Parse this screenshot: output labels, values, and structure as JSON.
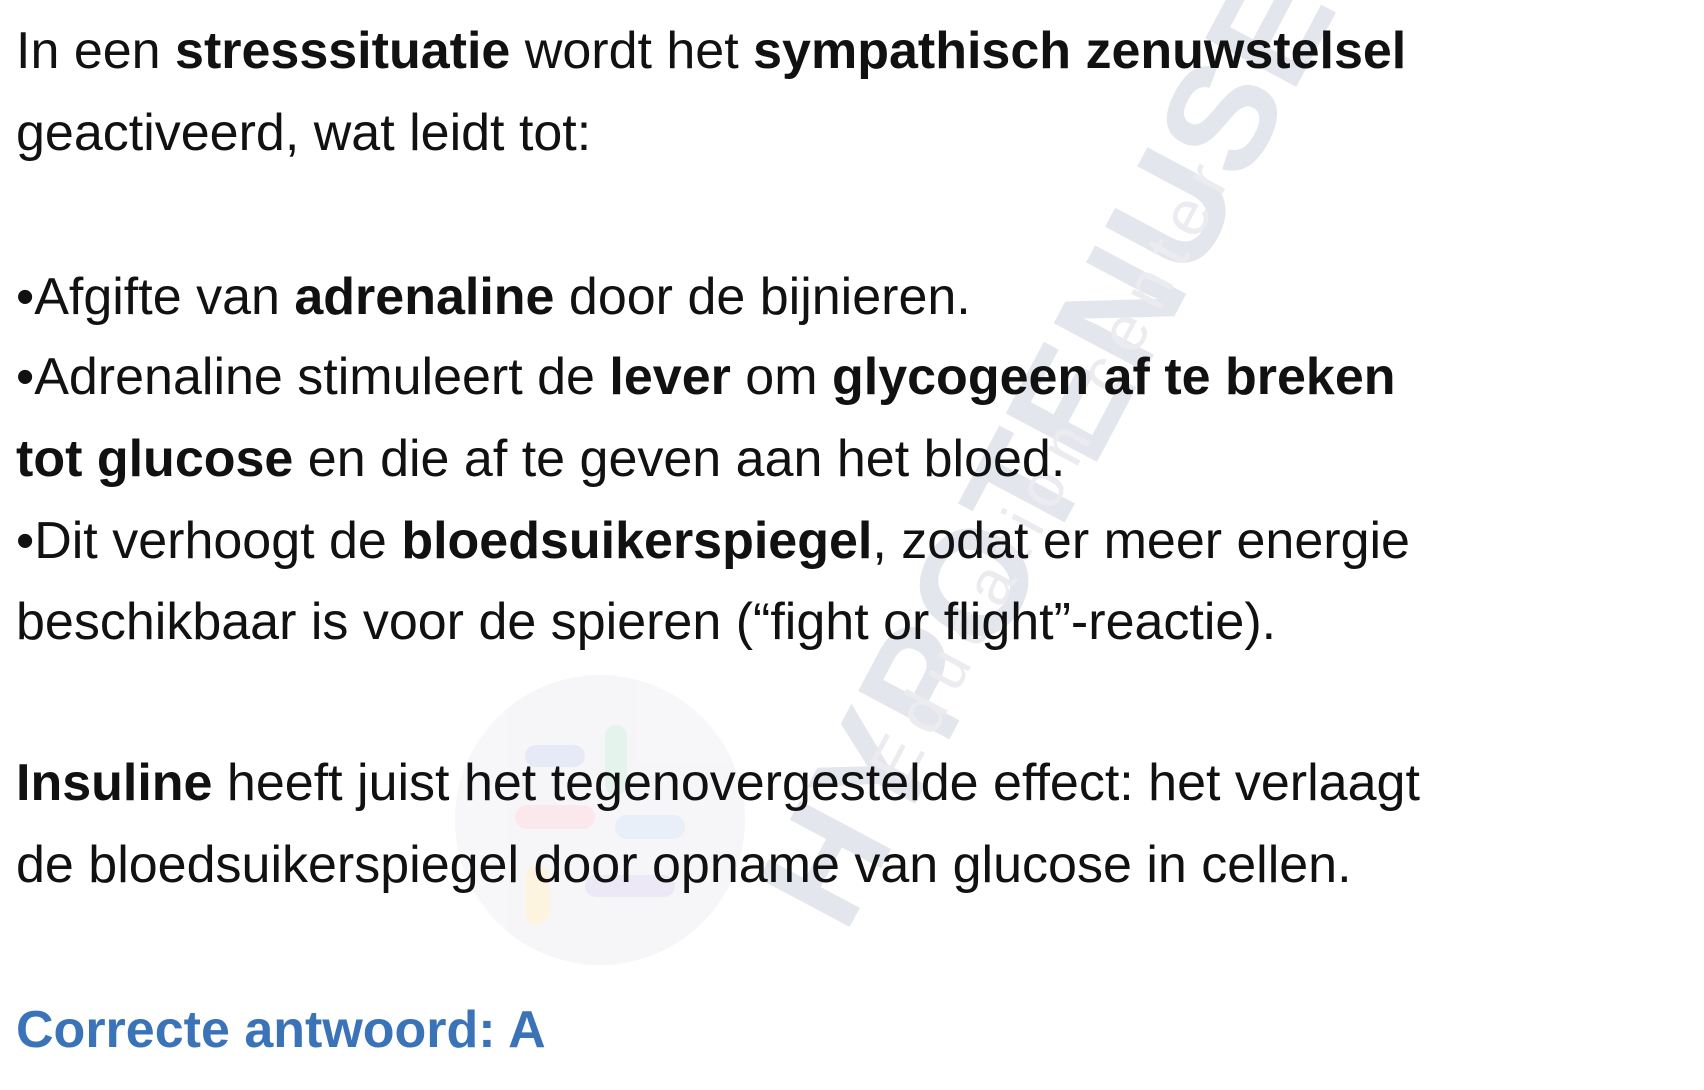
{
  "watermark": {
    "brand": "HYPOTENUSE",
    "subtitle": "Education center"
  },
  "intro": {
    "t1": "In een ",
    "b1": "stresssituatie",
    "t2": " wordt het ",
    "b2": "sympathisch zenuwstelsel",
    "t3": "geactiveerd, wat leidt tot:"
  },
  "bullets": [
    {
      "t1": "•Afgifte van ",
      "b1": "adrenaline",
      "t2": " door de bijnieren."
    },
    {
      "t1": "•Adrenaline stimuleert de ",
      "b1": "lever",
      "t2": " om ",
      "b2": "glycogeen af te breken",
      "b3": "tot glucose",
      "t3": " en die af te geven aan het bloed."
    },
    {
      "t1": "•Dit verhoogt de ",
      "b1": "bloedsuikerspiegel",
      "t2": ", zodat er meer energie",
      "t3": "beschikbaar is voor de spieren (“fight or flight”-reactie)."
    }
  ],
  "insulin": {
    "b1": "Insuline",
    "t1": " heeft juist het tegenovergestelde effect: het verlaagt",
    "t2": "de bloedsuikerspiegel door opname van glucose in cellen."
  },
  "answer": {
    "label": "Correcte antwoord: A",
    "color": "#3b73b9"
  }
}
